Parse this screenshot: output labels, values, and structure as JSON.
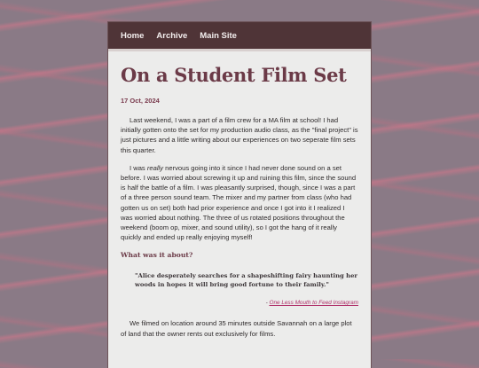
{
  "nav": {
    "items": [
      {
        "label": "Home"
      },
      {
        "label": "Archive"
      },
      {
        "label": "Main Site"
      }
    ]
  },
  "post": {
    "title": "On a Student Film Set",
    "date": "17 Oct, 2024",
    "p1": "Last weekend, I was a part of a film crew for a MA film at school! I had initially gotten onto the set for my production audio class, as the \"final project\" is just pictures and a little writing about our experiences on two seperate film sets this quarter.",
    "p2_before": "I was ",
    "p2_emph": "really",
    "p2_after": " nervous going into it since I had never done sound on a set before. I was worried about screwing it up and ruining this film, since the sound is half the battle of a film. I was pleasantly surprised, though, since I was a part of a three person sound team. The mixer and my partner from class (who had gotten us on set) both had prior experience and once I got into it I realized I was worried about nothing. The three of us rotated positions throughout the weekend (boom op, mixer, and sound utility), so I got the hang of it really quickly and ended up really enjoying myself!",
    "subheading": "What was it about?",
    "quote": "\"Alice desperately searches for a shapeshifting fairy haunting her woods in hopes it will bring good fortune to their family.\"",
    "cite_prefix": "- ",
    "cite_link": "One Less Mouth to Feed Instagram",
    "p3": "We filmed on location around 35 minutes outside Savannah on a large plot of land that the owner rents out exclusively for films."
  }
}
